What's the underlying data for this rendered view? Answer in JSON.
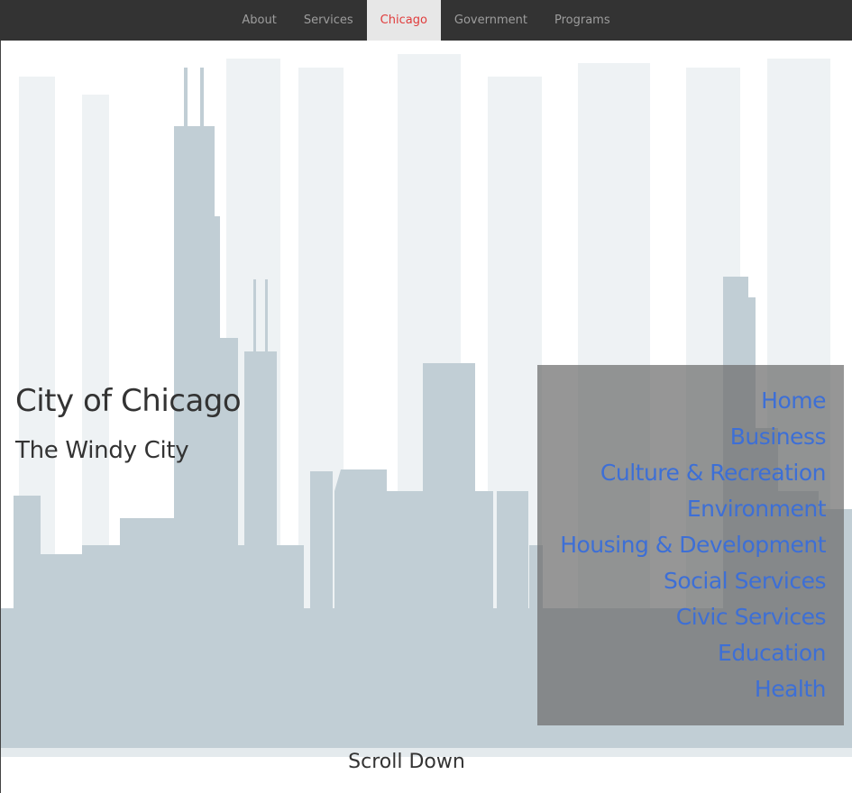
{
  "nav": {
    "items": [
      {
        "label": "About",
        "active": false
      },
      {
        "label": "Services",
        "active": false
      },
      {
        "label": "Chicago",
        "active": true
      },
      {
        "label": "Government",
        "active": false
      },
      {
        "label": "Programs",
        "active": false
      }
    ],
    "active_color": "#e03c3c",
    "background": "#333333"
  },
  "hero": {
    "title": "City of Chicago",
    "subtitle": "The Windy City",
    "background_image": "chicago-skyline-silhouette",
    "scroll_label": "Scroll Down"
  },
  "side_menu": {
    "items": [
      "Home",
      "Business",
      "Culture & Recreation",
      "Environment",
      "Housing & Development",
      "Social Services",
      "Civic Services",
      "Education",
      "Health"
    ],
    "link_color": "#3d6fd6"
  }
}
